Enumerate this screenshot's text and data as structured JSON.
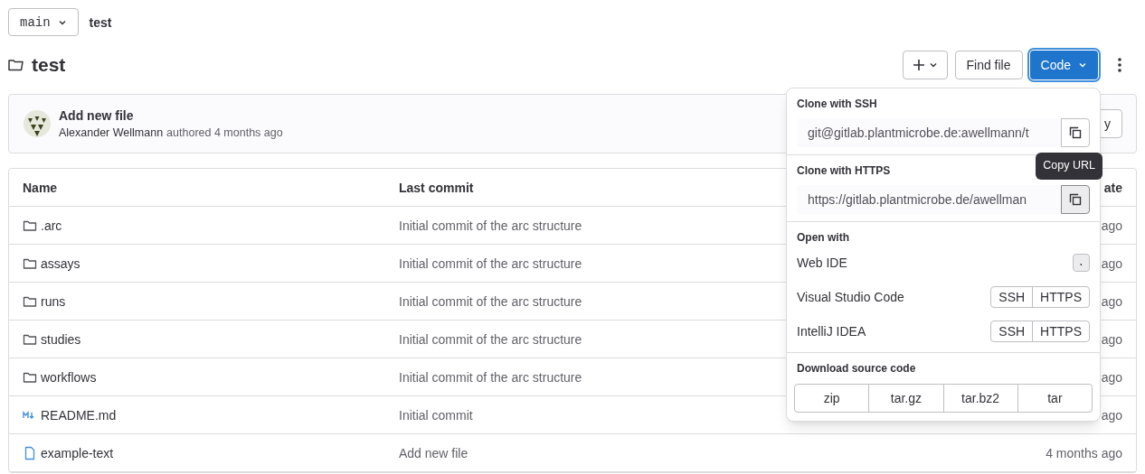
{
  "branch_selector": {
    "label": "main"
  },
  "breadcrumb": "test",
  "title": "test",
  "toolbar": {
    "find_file": "Find file",
    "code": "Code"
  },
  "last_commit": {
    "message": "Add new file",
    "author": "Alexander Wellmann",
    "meta": "authored 4 months ago",
    "button": "y"
  },
  "table": {
    "columns": [
      "Name",
      "Last commit",
      "ate"
    ],
    "rows": [
      {
        "kind": "folder",
        "name": ".arc",
        "commit": "Initial commit of the arc structure",
        "date": "ago"
      },
      {
        "kind": "folder",
        "name": "assays",
        "commit": "Initial commit of the arc structure",
        "date": "ago"
      },
      {
        "kind": "folder",
        "name": "runs",
        "commit": "Initial commit of the arc structure",
        "date": "ago"
      },
      {
        "kind": "folder",
        "name": "studies",
        "commit": "Initial commit of the arc structure",
        "date": "ago"
      },
      {
        "kind": "folder",
        "name": "workflows",
        "commit": "Initial commit of the arc structure",
        "date": "ago"
      },
      {
        "kind": "markdown",
        "name": "README.md",
        "commit": "Initial commit",
        "date": "ago"
      },
      {
        "kind": "file",
        "name": "example-text",
        "commit": "Add new file",
        "date": "4 months ago"
      }
    ]
  },
  "clone_dropdown": {
    "clone": [
      {
        "title": "Clone with SSH",
        "url": "git@gitlab.plantmicrobe.de:awellmann/t",
        "hovered": false
      },
      {
        "title": "Clone with HTTPS",
        "url": "https://gitlab.plantmicrobe.de/awellman",
        "hovered": true,
        "tooltip": "Copy URL"
      }
    ],
    "open_with": {
      "title": "Open with",
      "items": [
        {
          "kind": "shortcut",
          "label": "Web IDE",
          "key": "."
        },
        {
          "kind": "protocols",
          "label": "Visual Studio Code",
          "options": [
            "SSH",
            "HTTPS"
          ]
        },
        {
          "kind": "protocols",
          "label": "IntelliJ IDEA",
          "options": [
            "SSH",
            "HTTPS"
          ]
        }
      ]
    },
    "download": {
      "title": "Download source code",
      "formats": [
        "zip",
        "tar.gz",
        "tar.bz2",
        "tar"
      ]
    }
  }
}
